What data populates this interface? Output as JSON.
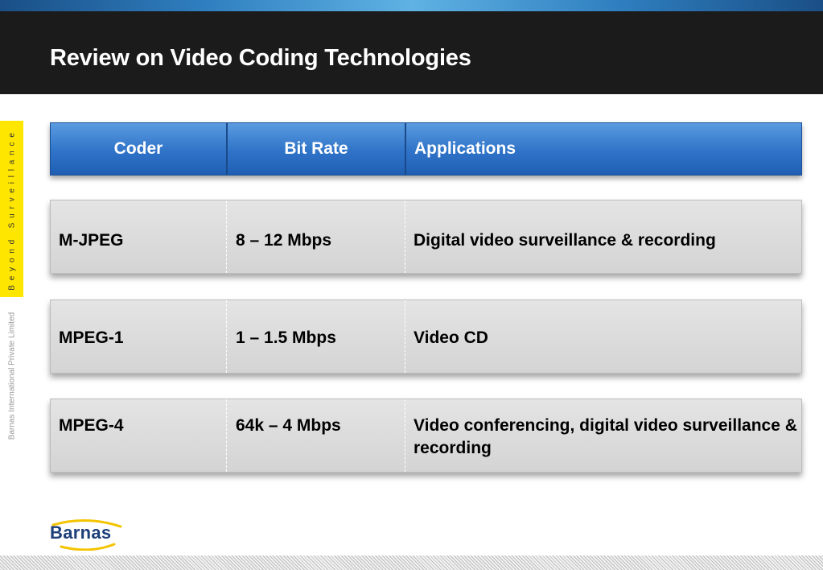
{
  "slide": {
    "title": "Review on Video Coding Technologies",
    "tagline": "Beyond Surveillance",
    "company": "Barnas International Private Limited",
    "logo_text": "Barnas"
  },
  "table": {
    "headers": [
      "Coder",
      "Bit Rate",
      "Applications"
    ],
    "rows": [
      {
        "coder": "M-JPEG",
        "bit_rate": "8 – 12 Mbps",
        "applications": "Digital video surveillance & recording"
      },
      {
        "coder": "MPEG-1",
        "bit_rate": "1 – 1.5 Mbps",
        "applications": "Video CD"
      },
      {
        "coder": "MPEG-4",
        "bit_rate": "64k – 4 Mbps",
        "applications": "Video conferencing, digital video surveillance & recording"
      }
    ]
  },
  "colors": {
    "header_bar": "#1b1b1b",
    "table_header": "#2f73c8",
    "row_fill": "#d9d9d9",
    "accent_yellow": "#ffe600",
    "logo_blue": "#1d3f7a",
    "logo_swoosh": "#f5c400"
  }
}
